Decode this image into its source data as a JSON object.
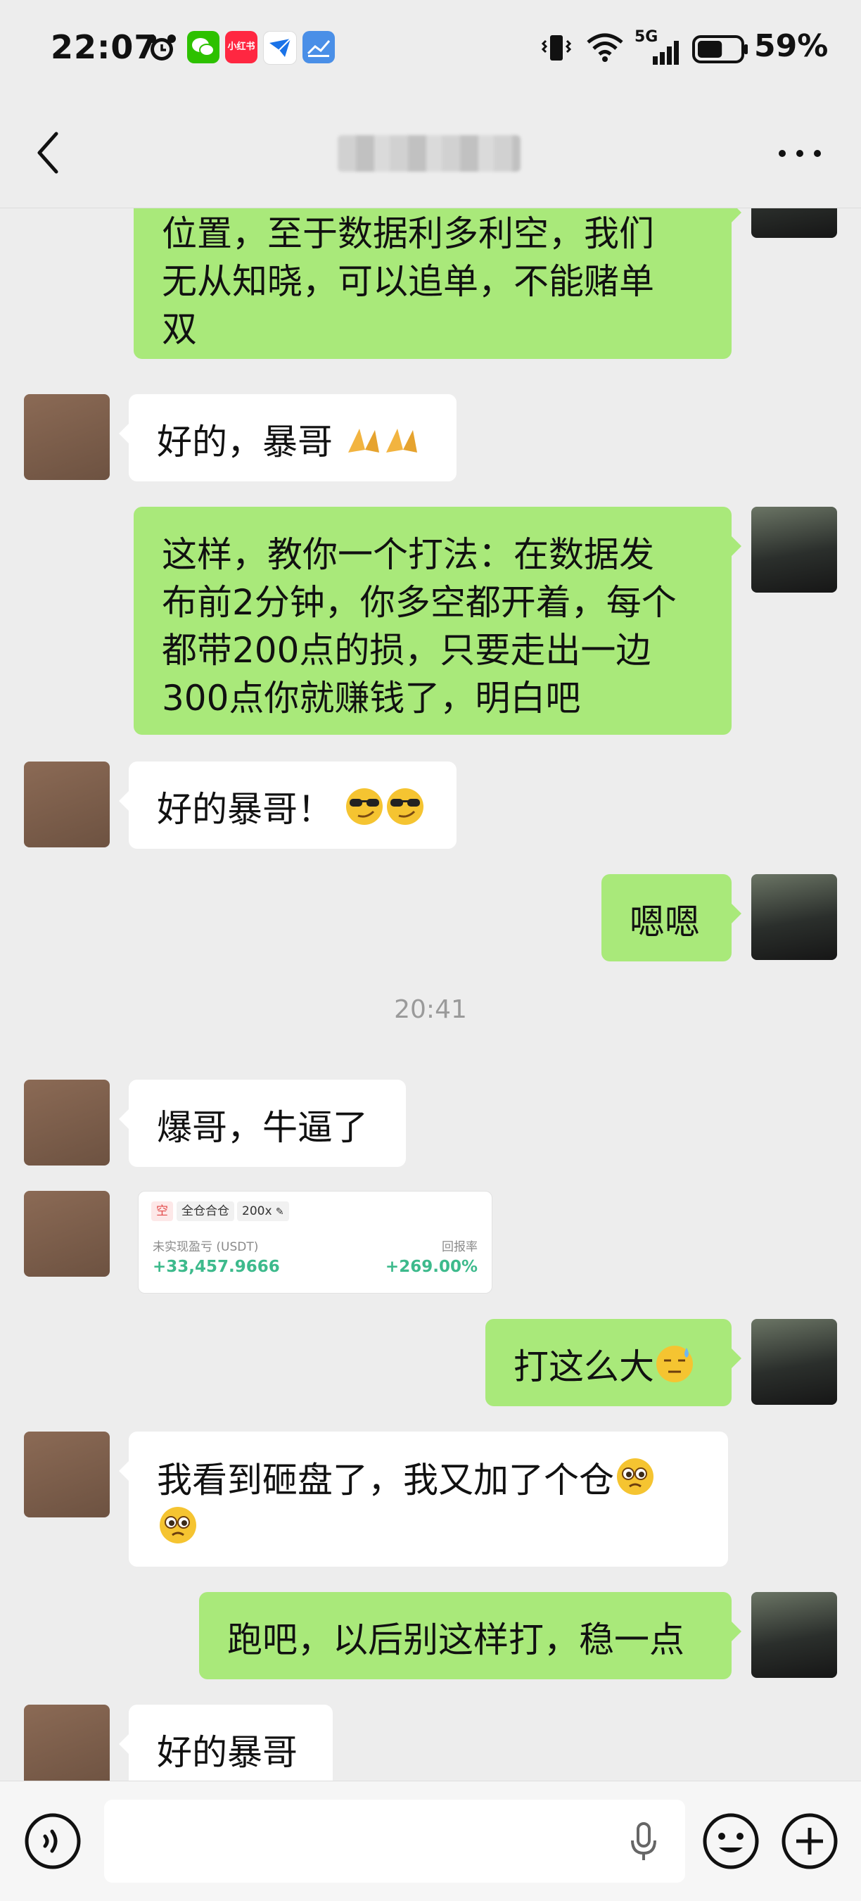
{
  "status_bar": {
    "time": "22:07",
    "network_label": "5G",
    "battery_percent": "59%",
    "battery_level": 0.59,
    "notification_icons": [
      "alarm-icon",
      "wechat-icon",
      "xiaohongshu-icon",
      "email-app-icon",
      "chart-app-icon"
    ],
    "xiaohongshu_label": "小红书"
  },
  "nav": {
    "title_blurred": true,
    "back_icon": "chevron-left-icon",
    "more_icon": "more-dots-icon"
  },
  "messages": [
    {
      "side": "self",
      "text": "位置，至于数据利多利空，我们\n无从知晓，可以追单，不能赌单\n双"
    },
    {
      "side": "other",
      "text": "好的，暴哥",
      "emoji": [
        "folded-hands-emoji",
        "folded-hands-emoji"
      ]
    },
    {
      "side": "self",
      "text": "这样，教你一个打法：在数据发\n布前2分钟，你多空都开着，每个\n都带200点的损，只要走出一边\n300点你就赚钱了，明白吧"
    },
    {
      "side": "other",
      "text": "好的暴哥！",
      "emoji": [
        "smirk-sunglasses-emoji",
        "smirk-sunglasses-emoji"
      ]
    },
    {
      "side": "self",
      "text": "嗯嗯"
    },
    {
      "timestamp": "20:41"
    },
    {
      "side": "other",
      "text": "爆哥，牛逼了"
    },
    {
      "side": "other",
      "type": "trade_card"
    },
    {
      "side": "self",
      "text": "打这么大",
      "emoji": [
        "sweat-emoji"
      ]
    },
    {
      "side": "other",
      "text": "我看到砸盘了，我又加了个仓",
      "emoji": [
        "pleading-emoji",
        "pleading-emoji"
      ]
    },
    {
      "side": "self",
      "text": "跑吧，以后别这样打，稳一点"
    },
    {
      "side": "other",
      "text": "好的暴哥"
    }
  ],
  "trade_card": {
    "direction_tag": "空",
    "margin_tag": "全仓合仓",
    "leverage_tag": "200x",
    "pnl_label": "未实现盈亏 (USDT)",
    "pnl_value": "+33,457.9666",
    "roi_label": "回报率",
    "roi_value": "+269.00%",
    "profit_color": "#3dba8c"
  },
  "input_bar": {
    "voice_icon": "voice-toggle-icon",
    "mic_icon": "microphone-icon",
    "emoji_icon": "emoji-icon",
    "plus_icon": "plus-icon"
  },
  "colors": {
    "background": "#ededed",
    "self_bubble": "#a9e97a",
    "other_bubble": "#ffffff"
  }
}
